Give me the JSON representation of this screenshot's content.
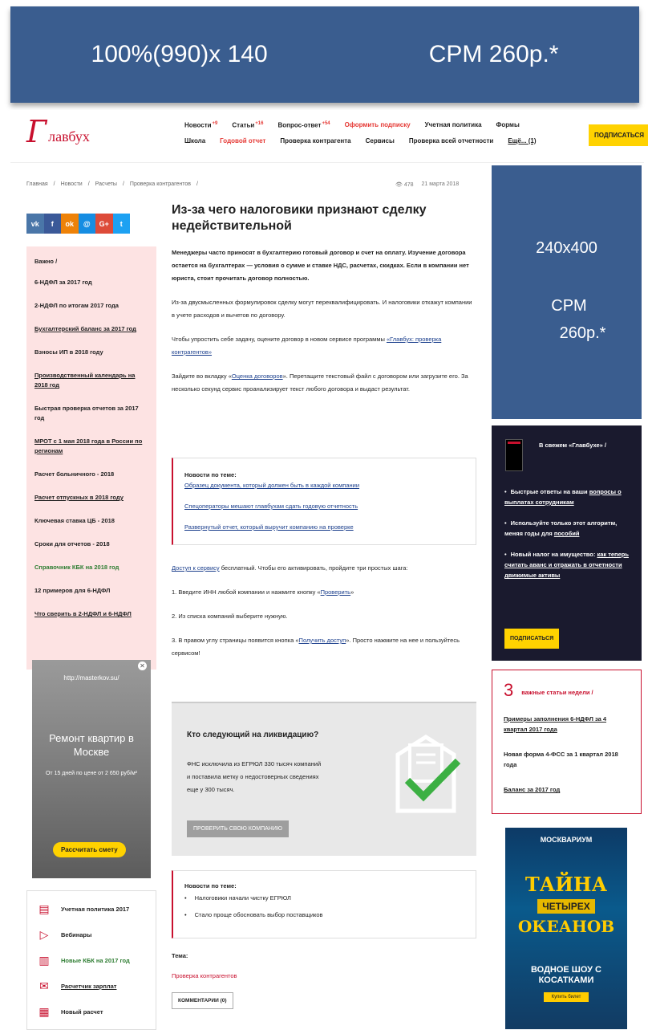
{
  "top_banner": {
    "size": "100%(990)x 140",
    "cpm": "CPM 260р.*"
  },
  "header": {
    "logo_initial": "Г",
    "logo_rest": "лавбух",
    "nav_row1": [
      {
        "label": "Новости",
        "badge": "+9"
      },
      {
        "label": "Статьи",
        "badge": "+16"
      },
      {
        "label": "Вопрос-ответ",
        "badge": "+54"
      },
      {
        "label": "Оформить подписку",
        "badge": ""
      },
      {
        "label": "Учетная политика",
        "badge": ""
      },
      {
        "label": "Формы",
        "badge": ""
      }
    ],
    "nav_row2": [
      "Школа",
      "Годовой отчет",
      "Проверка контрагента",
      "Сервисы",
      "Проверка всей отчетности",
      "Ещё... (1)"
    ],
    "subscribe_button": "ПОДПИСАТЬСЯ"
  },
  "breadcrumb": [
    "Главная",
    "/",
    "Новости",
    "/",
    "Расчеты",
    "/",
    "Проверка контрагентов",
    "/"
  ],
  "meta": {
    "views": "👁 478",
    "date": "21 марта 2018"
  },
  "right_ad": {
    "size": "240x400",
    "cpm": "CPM",
    "price": "260р.*"
  },
  "social": [
    {
      "icon": "vk-icon",
      "glyph": "vk",
      "color": "#4a76a8"
    },
    {
      "icon": "facebook-icon",
      "glyph": "f",
      "color": "#3b5998"
    },
    {
      "icon": "odnoklassniki-icon",
      "glyph": "ok",
      "color": "#ee8208"
    },
    {
      "icon": "mailru-icon",
      "glyph": "@",
      "color": "#168de2"
    },
    {
      "icon": "googleplus-icon",
      "glyph": "G+",
      "color": "#dd4b39"
    },
    {
      "icon": "twitter-icon",
      "glyph": "t",
      "color": "#1da1f2"
    }
  ],
  "important": {
    "title": "Важно  /",
    "items": [
      {
        "text": "6-НДФЛ за 2017 год",
        "style": ""
      },
      {
        "text": "2-НДФЛ по итогам 2017 года",
        "style": ""
      },
      {
        "text": "Бухгалтерский баланс за 2017 год",
        "style": "u"
      },
      {
        "text": "Взносы ИП в 2018 году",
        "style": ""
      },
      {
        "text": "Производственный календарь на 2018 год",
        "style": "u"
      },
      {
        "text": "Быстрая проверка отчетов за 2017 год",
        "style": ""
      },
      {
        "text": "МРОТ с 1 мая 2018 года в России по регионам",
        "style": "u"
      },
      {
        "text": "Расчет больничного - 2018",
        "style": ""
      },
      {
        "text": "Расчет отпускных в 2018 году",
        "style": "u"
      },
      {
        "text": "Ключевая ставка ЦБ - 2018",
        "style": ""
      },
      {
        "text": "Сроки для отчетов - 2018",
        "style": ""
      },
      {
        "text": "Справочник КБК на 2018 год",
        "style": "green"
      },
      {
        "text": "12 примеров для 6-НДФЛ",
        "style": ""
      },
      {
        "text": "Что сверить в 2-НДФЛ и 6-НДФЛ",
        "style": "u"
      }
    ]
  },
  "left_ad": {
    "url": "http://masterkov.su/",
    "headline": "Ремонт квартир в Москве",
    "sub": "От 15 дней по цене от 2 650 руб/м²",
    "button": "Рассчитать смету"
  },
  "services": [
    {
      "icon": "document-icon",
      "glyph": "▤",
      "label": "Учетная политика 2017",
      "style": ""
    },
    {
      "icon": "play-icon",
      "glyph": "▷",
      "label": "Вебинары",
      "style": ""
    },
    {
      "icon": "table-icon",
      "glyph": "▥",
      "label": "Новые КБК на 2017 год",
      "style": "green"
    },
    {
      "icon": "chat-icon",
      "glyph": "✉",
      "label": "Расчетчик зарплат",
      "style": "u"
    },
    {
      "icon": "calc-icon",
      "glyph": "▦",
      "label": "Новый расчет",
      "style": ""
    }
  ],
  "article": {
    "title": "Из-за чего налоговики признают сделку недействительной",
    "lead": "Менеджеры часто приносят в бухгалтерию готовый договор и счет на оплату. Изучение договора остается на бухгалтерах — условия о сумме и ставке НДС, расчетах, скидках. Если в компании нет юриста, стоит прочитать договор полностью.",
    "p1": "Из-за двусмысленных формулировок сделку могут переквалифицировать. И налоговики откажут компании в учете расходов и вычетов по договору.",
    "p2_text": "Чтобы упростить себе задачу, оцените договор в новом сервисе программы",
    "p2_link": "«Главбух: проверка контрагентов»",
    "p3_a": "Зайдите во вкладку «",
    "p3_link": "Оценка договоров",
    "p3_b": "». Перетащите текстовый файл с договором или загрузите его. За несколько секунд сервис проанализирует текст любого договора и выдаст результат."
  },
  "news_box": {
    "title": "Новости по теме:",
    "links": [
      "Образец документа, который должен быть в каждой компании",
      "Спецоператоры мешают главбухам сдать годовую отчетность",
      "Развернутый отчет, который выручит компанию на проверке"
    ]
  },
  "steps": {
    "access_link": "Доступ к сервису",
    "access_text": " бесплатный. Чтобы его активировать, пройдите три простых шага:",
    "step1_a": "1. Введите ИНН любой компании и нажмите кнопку «",
    "step1_link": "Проверить",
    "step1_b": "»",
    "step2": "2. Из списка компаний выберите нужную.",
    "step3_a": "3. В правом углу страницы появится кнопка «",
    "step3_link": "Получить доступ",
    "step3_b": "». Просто нажмите на нее и пользуйтесь сервисом!"
  },
  "promo": {
    "title": "Кто следующий на ликвидацию?",
    "desc": "ФНС исключила из ЕГРЮЛ 330 тысяч компаний и поставила метку о недостоверных сведениях еще у 300 тысяч.",
    "button": "ПРОВЕРИТЬ СВОЮ КОМПАНИЮ"
  },
  "news2": {
    "title": "Новости по теме:",
    "items": [
      "Налоговики начали чистку ЕГРЮЛ",
      "Стало проще обосновать выбор поставщиков"
    ]
  },
  "tema": {
    "title": "Тема:",
    "link": "Проверка контрагентов"
  },
  "comments_button": "КОММЕНТАРИИ (0)",
  "dark_box": {
    "title": "В свежем «Главбухе»  /",
    "items": [
      {
        "a": "Быстрые ответы на ваши",
        "b": "вопросы о выплатах сотрудникам"
      },
      {
        "a": "Используйте только этот алгоритм, меняя годы для",
        "b": "пособий"
      },
      {
        "a": "Новый налог на имущество:",
        "b": "как теперь считать аванс и отражать в отчетности движимые активы"
      }
    ],
    "button": "ПОДПИСАТЬСЯ"
  },
  "weekly": {
    "num": "3",
    "title": "важные статьи недели  /",
    "items": [
      {
        "text": "Примеры заполнения 6-НДФЛ за 4 квартал 2017 года",
        "style": "u"
      },
      {
        "text": "Новая форма 4-ФСС за 1 квартал 2018 года",
        "style": ""
      },
      {
        "text": "Баланс за 2017 год",
        "style": "u"
      }
    ]
  },
  "oceanarium": {
    "brand": "МОСКВАРИУМ",
    "t1": "ТАЙНА",
    "t2": "ЧЕТЫРЕХ",
    "t3": "ОКЕАНОВ",
    "t4": "ВОДНОЕ ШОУ С КОСАТКАМИ",
    "button": "Купить билет"
  }
}
